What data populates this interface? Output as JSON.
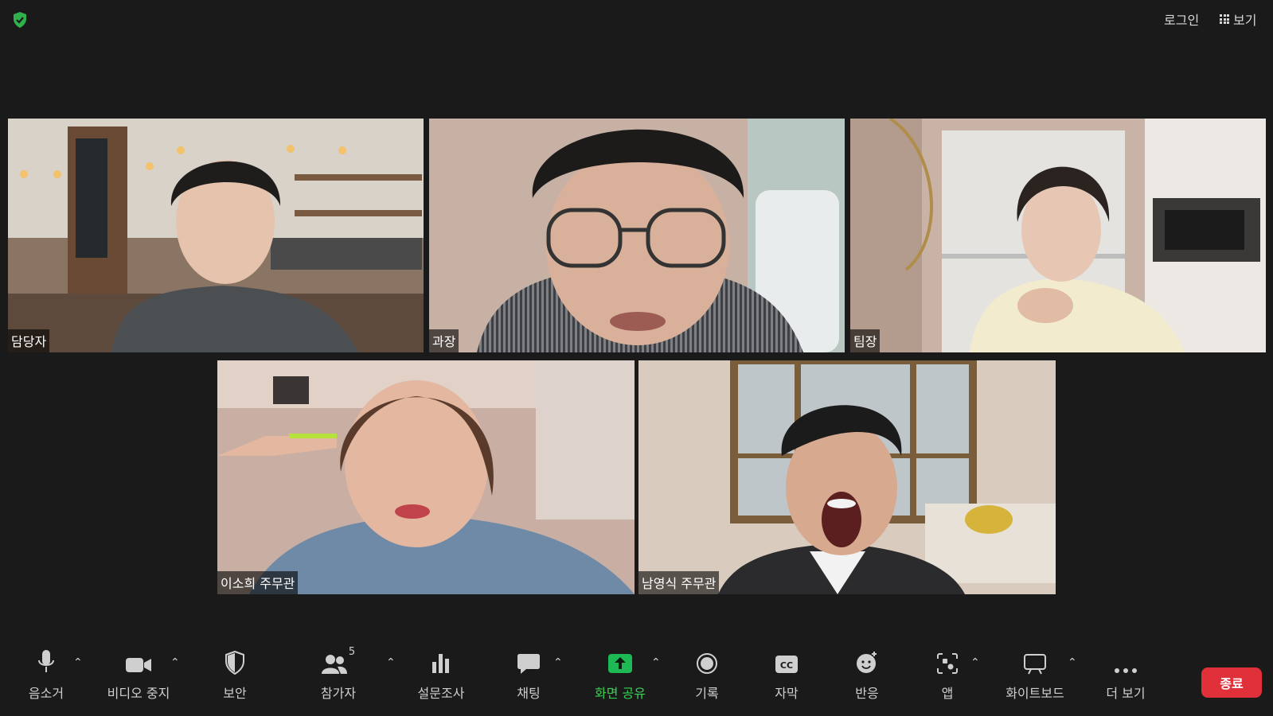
{
  "topbar": {
    "login_label": "로그인",
    "view_label": "보기"
  },
  "participants": [
    {
      "name": "담당자",
      "active": false
    },
    {
      "name": "과장",
      "active": false
    },
    {
      "name": "팀장",
      "active": false
    },
    {
      "name": "이소희 주무관",
      "active": false
    },
    {
      "name": "남영식 주무관",
      "active": true
    }
  ],
  "toolbar": {
    "mute_label": "음소거",
    "video_label": "비디오 중지",
    "security_label": "보안",
    "participants_label": "참가자",
    "participants_count": "5",
    "poll_label": "설문조사",
    "chat_label": "채팅",
    "share_label": "화면 공유",
    "record_label": "기록",
    "cc_label": "자막",
    "cc_icon_text": "CC",
    "reactions_label": "반응",
    "apps_label": "앱",
    "whiteboard_label": "화이트보드",
    "more_label": "더 보기",
    "end_label": "종료"
  },
  "colors": {
    "background": "#1a1a1a",
    "active_speaker": "#5ad44d",
    "share_green": "#39d353",
    "end_red": "#e0303a"
  }
}
